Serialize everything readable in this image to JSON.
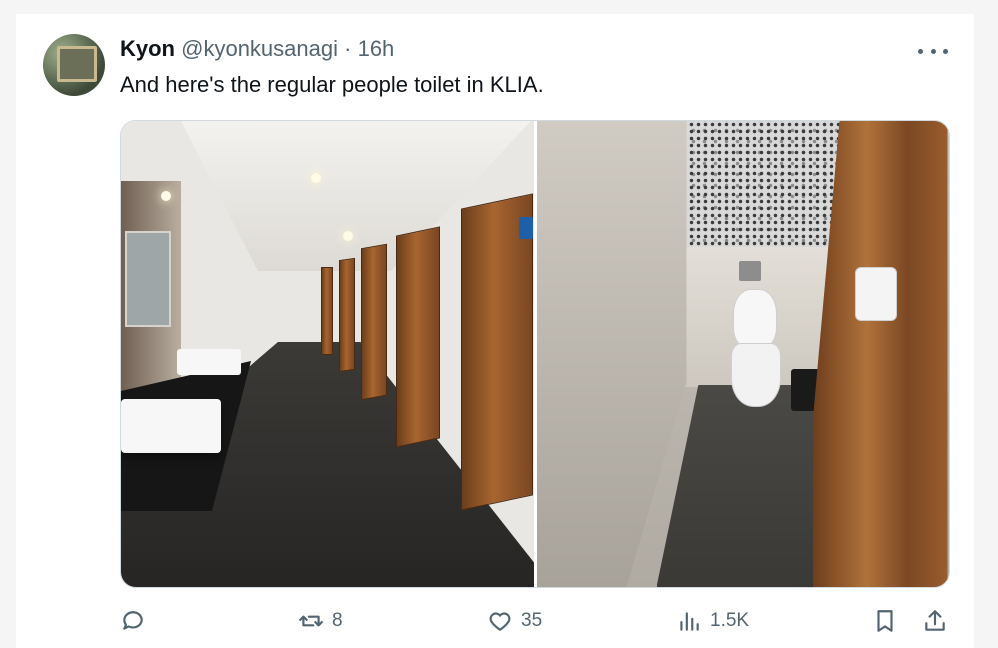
{
  "tweet": {
    "author_name": "Kyon",
    "handle": "@kyonkusanagi",
    "separator": "·",
    "time": "16h",
    "text": "And here's the regular people toilet in KLIA."
  },
  "media": {
    "photos": [
      "left-photo",
      "right-photo"
    ]
  },
  "actions": {
    "reply_icon": "reply-icon",
    "retweet_count": "8",
    "like_count": "35",
    "views_count": "1.5K",
    "bookmark_icon": "bookmark-icon",
    "share_icon": "share-icon"
  },
  "colors": {
    "text": "#0f1419",
    "secondary": "#536471",
    "border": "#cfd9de"
  }
}
